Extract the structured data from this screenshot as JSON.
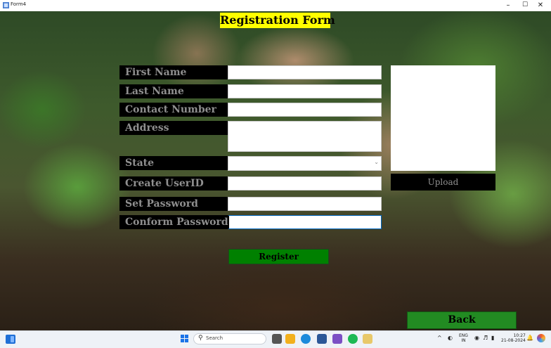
{
  "window": {
    "title": "Form4",
    "minimize": "–",
    "maximize": "☐",
    "close": "✕"
  },
  "form": {
    "heading": "Registration Form",
    "labels": {
      "first_name": "First Name",
      "last_name": "Last Name",
      "contact_number": "Contact Number",
      "address": "Address",
      "state": "State",
      "create_userid": "Create UserID",
      "set_password": "Set Password",
      "conform_password": "Conform Password"
    },
    "values": {
      "first_name": "",
      "last_name": "",
      "contact_number": "",
      "address": "",
      "state": "",
      "create_userid": "",
      "set_password": "",
      "conform_password": ""
    },
    "upload_label": "Upload",
    "register_label": "Register",
    "back_label": "Back"
  },
  "taskbar": {
    "search_placeholder": "Search",
    "language": "ENG",
    "region": "IN",
    "time": "10:27",
    "date": "21-08-2024"
  },
  "icons": [
    "app-icon",
    "minimize-icon",
    "maximize-icon",
    "close-icon",
    "chevron-down-icon",
    "widgets-icon",
    "start-icon",
    "search-icon",
    "file-explorer-icon",
    "edge-icon",
    "store-icon",
    "visual-studio-icon",
    "spotify-icon",
    "form-app-icon",
    "chevron-up-icon",
    "network-icon",
    "volume-icon",
    "battery-icon",
    "notification-icon",
    "copilot-icon"
  ]
}
